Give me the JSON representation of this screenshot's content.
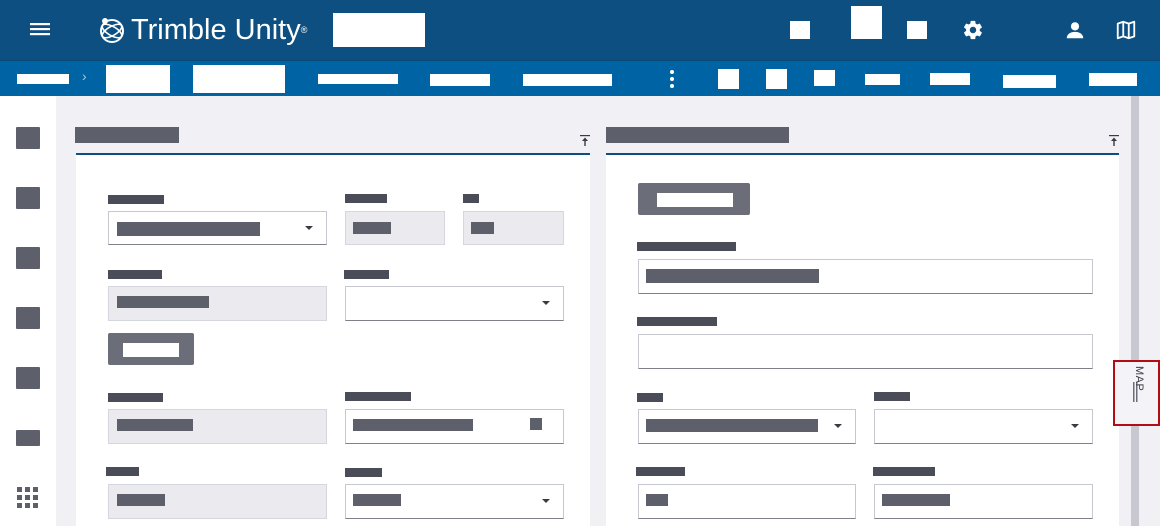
{
  "header": {
    "brand": "Trimble Unity",
    "brand_mark": "®",
    "menu_icon": "hamburger-menu-icon",
    "settings_icon": "gear-icon",
    "user_icon": "user-icon",
    "map_icon": "map-icon"
  },
  "subnav": {
    "more_icon": "vertical-ellipsis-icon",
    "breadcrumb_separator": "›"
  },
  "side_tab": {
    "label": "MAP"
  },
  "left_nav": {
    "apps_icon": "apps-grid-icon"
  },
  "colors": {
    "header_bg": "#0c4f80",
    "subnav_bg": "#0063a3",
    "accent_rule": "#0c4f80",
    "highlight_border": "#b20d14"
  }
}
